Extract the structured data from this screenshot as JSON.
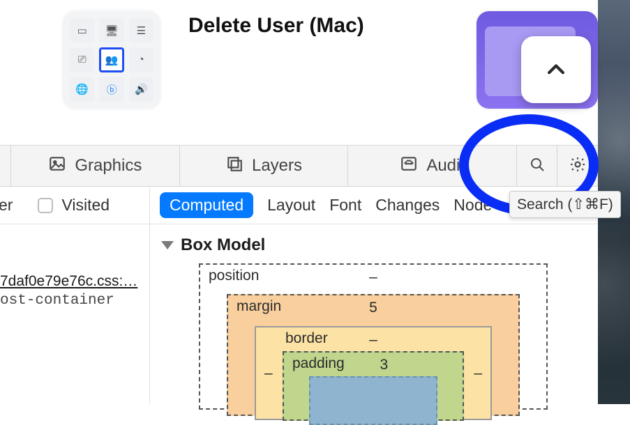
{
  "title": "Delete User (Mac)",
  "toolbar": {
    "graphics": "Graphics",
    "layers": "Layers",
    "audit": "Audit"
  },
  "subrow": {
    "partial": "er",
    "visited": "Visited",
    "tabs": {
      "computed": "Computed",
      "layout": "Layout",
      "font": "Font",
      "changes": "Changes",
      "node": "Node"
    }
  },
  "leftpane": {
    "css_link": "7daf0e79e76c.css:…",
    "rule": "ost-container"
  },
  "tooltip": "Search (⇧⌘F)",
  "boxmodel": {
    "heading": "Box Model",
    "position": {
      "label": "position",
      "top": "–"
    },
    "margin": {
      "label": "margin",
      "top": "5"
    },
    "border": {
      "label": "border",
      "top": "–",
      "left": "–",
      "right": "–"
    },
    "padding": {
      "label": "padding",
      "top": "3"
    }
  }
}
